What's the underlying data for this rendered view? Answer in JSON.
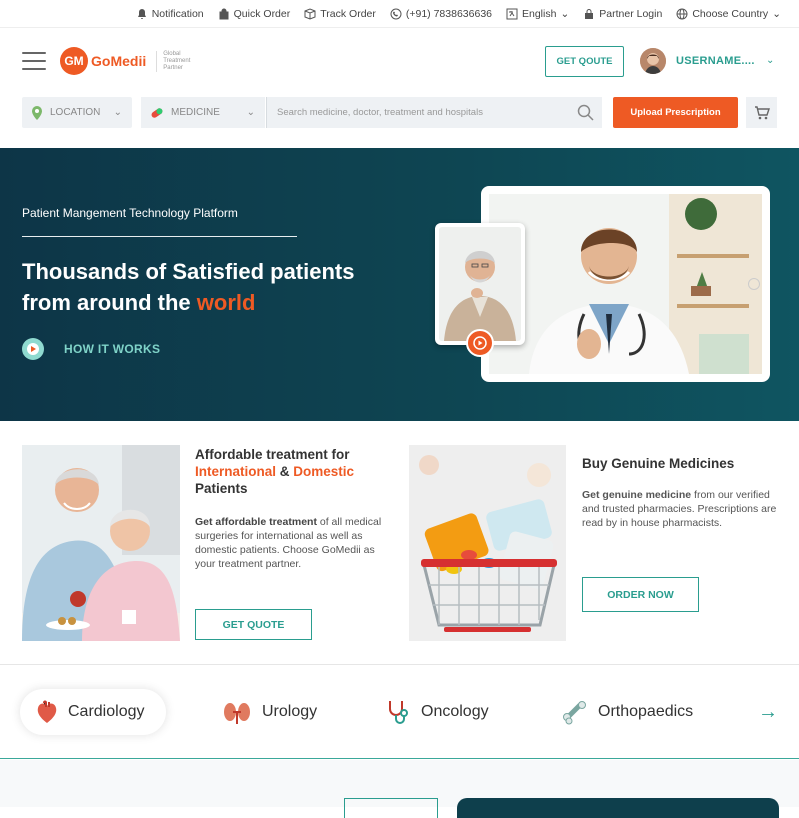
{
  "topbar": {
    "notification": "Notification",
    "quick_order": "Quick Order",
    "track_order": "Track Order",
    "phone": "(+91) 7838636636",
    "language": "English",
    "partner_login": "Partner Login",
    "choose_country": "Choose Country"
  },
  "header": {
    "logo_mark": "GM",
    "logo_name": "GoMedii",
    "logo_tagline": "Global Treatment Partner",
    "get_quote": "GET QOUTE",
    "username": "USERNAME...."
  },
  "search": {
    "location": "LOCATION",
    "medicine": "MEDICINE",
    "placeholder": "Search medicine, doctor, treatment and hospitals",
    "upload": "Upload Prescription"
  },
  "hero": {
    "subtitle": "Patient Mangement Technology Platform",
    "title_line1": "Thousands of Satisfied patients",
    "title_line2_prefix": "from around the ",
    "title_accent": "world",
    "how_it_works": "HOW IT WORKS"
  },
  "card1": {
    "title_line1": "Affordable treatment for",
    "title_intl": "International",
    "title_amp": " & ",
    "title_domestic": "Domestic",
    "title_line3": "Patients",
    "text_bold": "Get affordable treatment",
    "text_rest": " of all medical surgeries for international as well as domestic patients. Choose GoMedii as your treatment partner.",
    "button": "GET QUOTE"
  },
  "card2": {
    "title": "Buy Genuine Medicines",
    "text_bold": "Get genuine medicine",
    "text_rest": " from our verified and trusted pharmacies. Prescriptions are read by in house pharmacists.",
    "button": "ORDER NOW"
  },
  "specialties": [
    {
      "label": "Cardiology",
      "icon": "heart-icon"
    },
    {
      "label": "Urology",
      "icon": "kidney-icon"
    },
    {
      "label": "Oncology",
      "icon": "stethoscope-icon"
    },
    {
      "label": "Orthopaedics",
      "icon": "bone-icon"
    }
  ],
  "colors": {
    "accent": "#ee5a24",
    "teal": "#2a9d8f",
    "hero_bg": "#0e4552"
  }
}
